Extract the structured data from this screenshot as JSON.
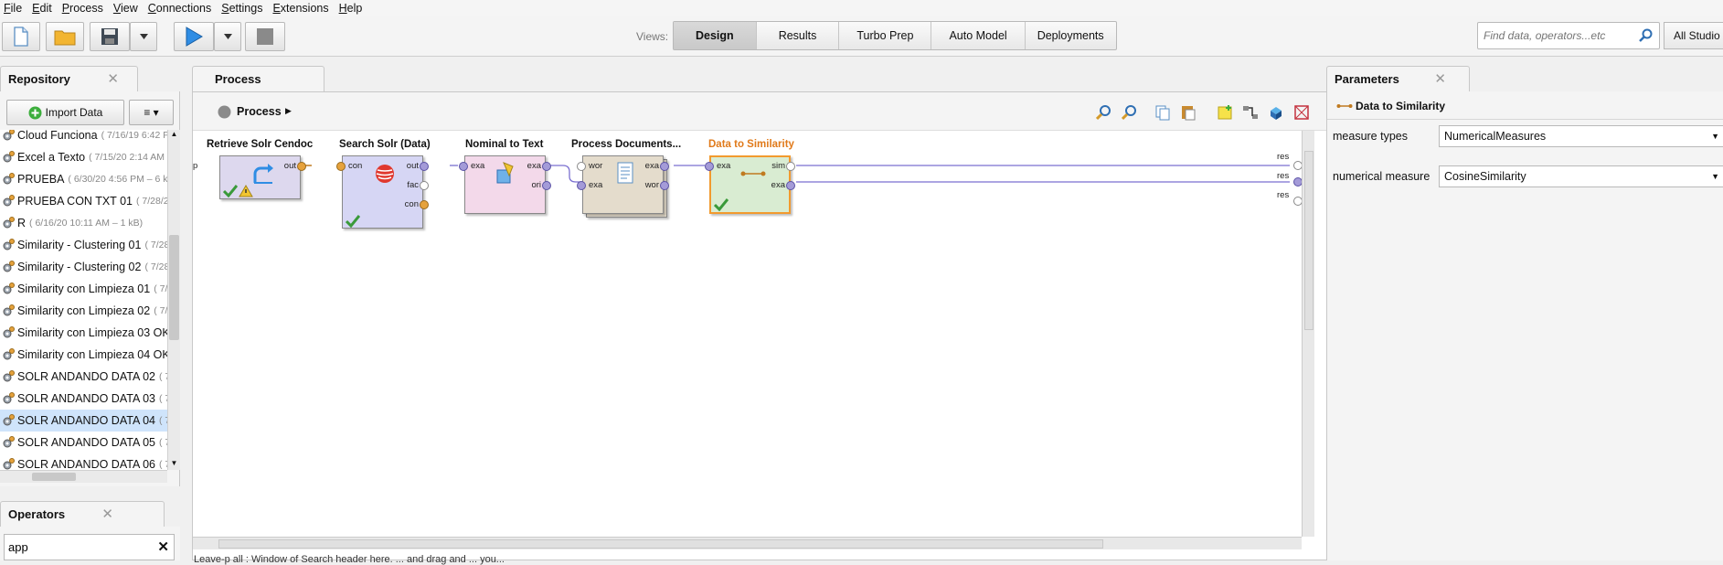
{
  "menu": [
    "File",
    "Edit",
    "Process",
    "View",
    "Connections",
    "Settings",
    "Extensions",
    "Help"
  ],
  "toolbar": {
    "views_label": "Views:",
    "views": [
      "Design",
      "Results",
      "Turbo Prep",
      "Auto Model",
      "Deployments"
    ],
    "search_placeholder": "Find data, operators...etc",
    "all_studio": "All Studio"
  },
  "repository": {
    "title": "Repository",
    "import_label": "Import Data",
    "menu_label": "≡ ▾",
    "items": [
      {
        "name": "Cloud Funciona",
        "meta": "( 7/16/19 6:42 P"
      },
      {
        "name": "Excel a Texto",
        "meta": "( 7/15/20 2:14 AM"
      },
      {
        "name": "PRUEBA",
        "meta": "( 6/30/20 4:56 PM – 6 k"
      },
      {
        "name": "PRUEBA CON TXT 01",
        "meta": "( 7/28/20"
      },
      {
        "name": "R",
        "meta": "( 6/16/20 10:11 AM – 1 kB)"
      },
      {
        "name": "Similarity - Clustering 01",
        "meta": "( 7/28"
      },
      {
        "name": "Similarity - Clustering 02",
        "meta": "( 7/28"
      },
      {
        "name": "Similarity con Limpieza 01",
        "meta": "( 7/"
      },
      {
        "name": "Similarity con Limpieza 02",
        "meta": "( 7/"
      },
      {
        "name": "Similarity con Limpieza 03 OK",
        "meta": ""
      },
      {
        "name": "Similarity con Limpieza 04 OK",
        "meta": ""
      },
      {
        "name": "SOLR ANDANDO DATA 02",
        "meta": "( 7/"
      },
      {
        "name": "SOLR ANDANDO DATA 03",
        "meta": "( 7/"
      },
      {
        "name": "SOLR ANDANDO DATA 04",
        "meta": "( 7/"
      },
      {
        "name": "SOLR ANDANDO DATA 05",
        "meta": "( 7/"
      },
      {
        "name": "SOLR ANDANDO DATA 06",
        "meta": "( 7/"
      }
    ],
    "selected_index": 13
  },
  "operators": {
    "title": "Operators",
    "search_value": "app"
  },
  "process": {
    "tab": "Process",
    "breadcrumb": "Process",
    "left_port": "p",
    "result_ports": [
      "res",
      "res",
      "res"
    ],
    "operators": [
      {
        "title": "Retrieve Solr Cendoc",
        "ports_out": [
          "out"
        ]
      },
      {
        "title": "Search Solr (Data)",
        "ports_in": [
          "con"
        ],
        "ports_out": [
          "out",
          "fac",
          "con"
        ]
      },
      {
        "title": "Nominal to Text",
        "ports_in": [
          "exa"
        ],
        "ports_out": [
          "exa",
          "ori"
        ]
      },
      {
        "title": "Process Documents...",
        "ports_in": [
          "wor",
          "exa"
        ],
        "ports_out": [
          "exa",
          "wor"
        ]
      },
      {
        "title": "Data to Similarity",
        "ports_in": [
          "exa"
        ],
        "ports_out": [
          "sim",
          "exa"
        ]
      }
    ],
    "status": "Leave-p all : Window of Search  header here. ... and drag and ... you..."
  },
  "parameters": {
    "title": "Parameters",
    "operator": "Data to Similarity",
    "rows": [
      {
        "label": "measure types",
        "value": "NumericalMeasures"
      },
      {
        "label": "numerical measure",
        "value": "CosineSimilarity"
      }
    ]
  }
}
